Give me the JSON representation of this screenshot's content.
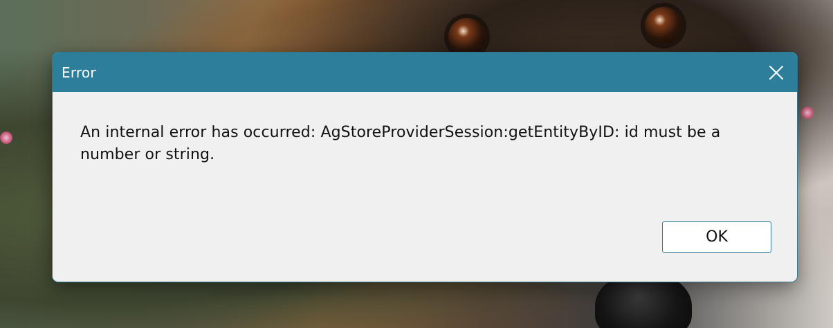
{
  "dialog": {
    "title": "Error",
    "message": "An internal error has occurred: AgStoreProviderSession:getEntityByID: id must be a number or string.",
    "ok_label": "OK",
    "close_icon": "close-icon"
  },
  "colors": {
    "titlebar_bg": "#2d7e9a",
    "dialog_bg": "#f0f0f0",
    "border": "#2b7a93",
    "button_bg": "#ffffff",
    "text": "#111111"
  }
}
